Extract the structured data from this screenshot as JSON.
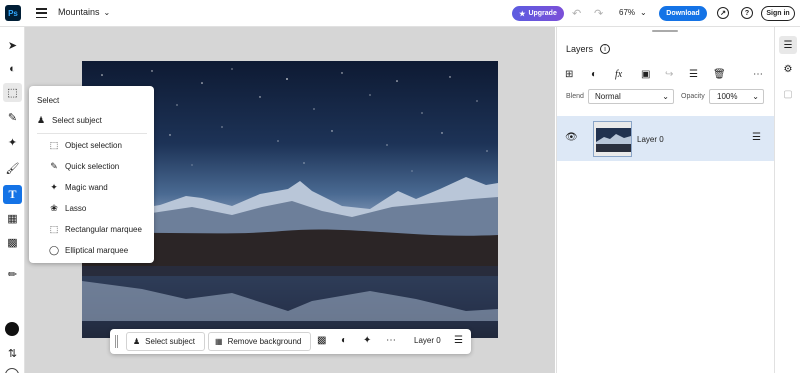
{
  "app": {
    "logo": "Ps",
    "document_title": "Mountains"
  },
  "header": {
    "upgrade_label": "Upgrade",
    "zoom": "67%",
    "download_label": "Download",
    "help_label": "?",
    "signin_label": "Sign in"
  },
  "flyout": {
    "title": "Select",
    "items": [
      {
        "label": "Select subject",
        "icon": "person-select-icon"
      },
      {
        "label": "Object selection",
        "icon": "object-selection-icon"
      },
      {
        "label": "Quick selection",
        "icon": "quick-selection-icon"
      },
      {
        "label": "Magic wand",
        "icon": "magic-wand-icon"
      },
      {
        "label": "Lasso",
        "icon": "lasso-icon"
      },
      {
        "label": "Rectangular marquee",
        "icon": "rectangular-marquee-icon"
      },
      {
        "label": "Elliptical marquee",
        "icon": "elliptical-marquee-icon"
      }
    ]
  },
  "contextbar": {
    "select_subject_label": "Select subject",
    "remove_background_label": "Remove background",
    "layer_label": "Layer 0"
  },
  "layers_panel": {
    "title": "Layers",
    "blend_label": "Blend",
    "blend_mode": "Normal",
    "opacity_label": "Opacity",
    "opacity_value": "100%",
    "layers": [
      {
        "name": "Layer 0"
      }
    ]
  },
  "colors": {
    "accent": "#1473e6",
    "upgrade": "#5c5ce0",
    "selected_row": "#dde8f6"
  }
}
